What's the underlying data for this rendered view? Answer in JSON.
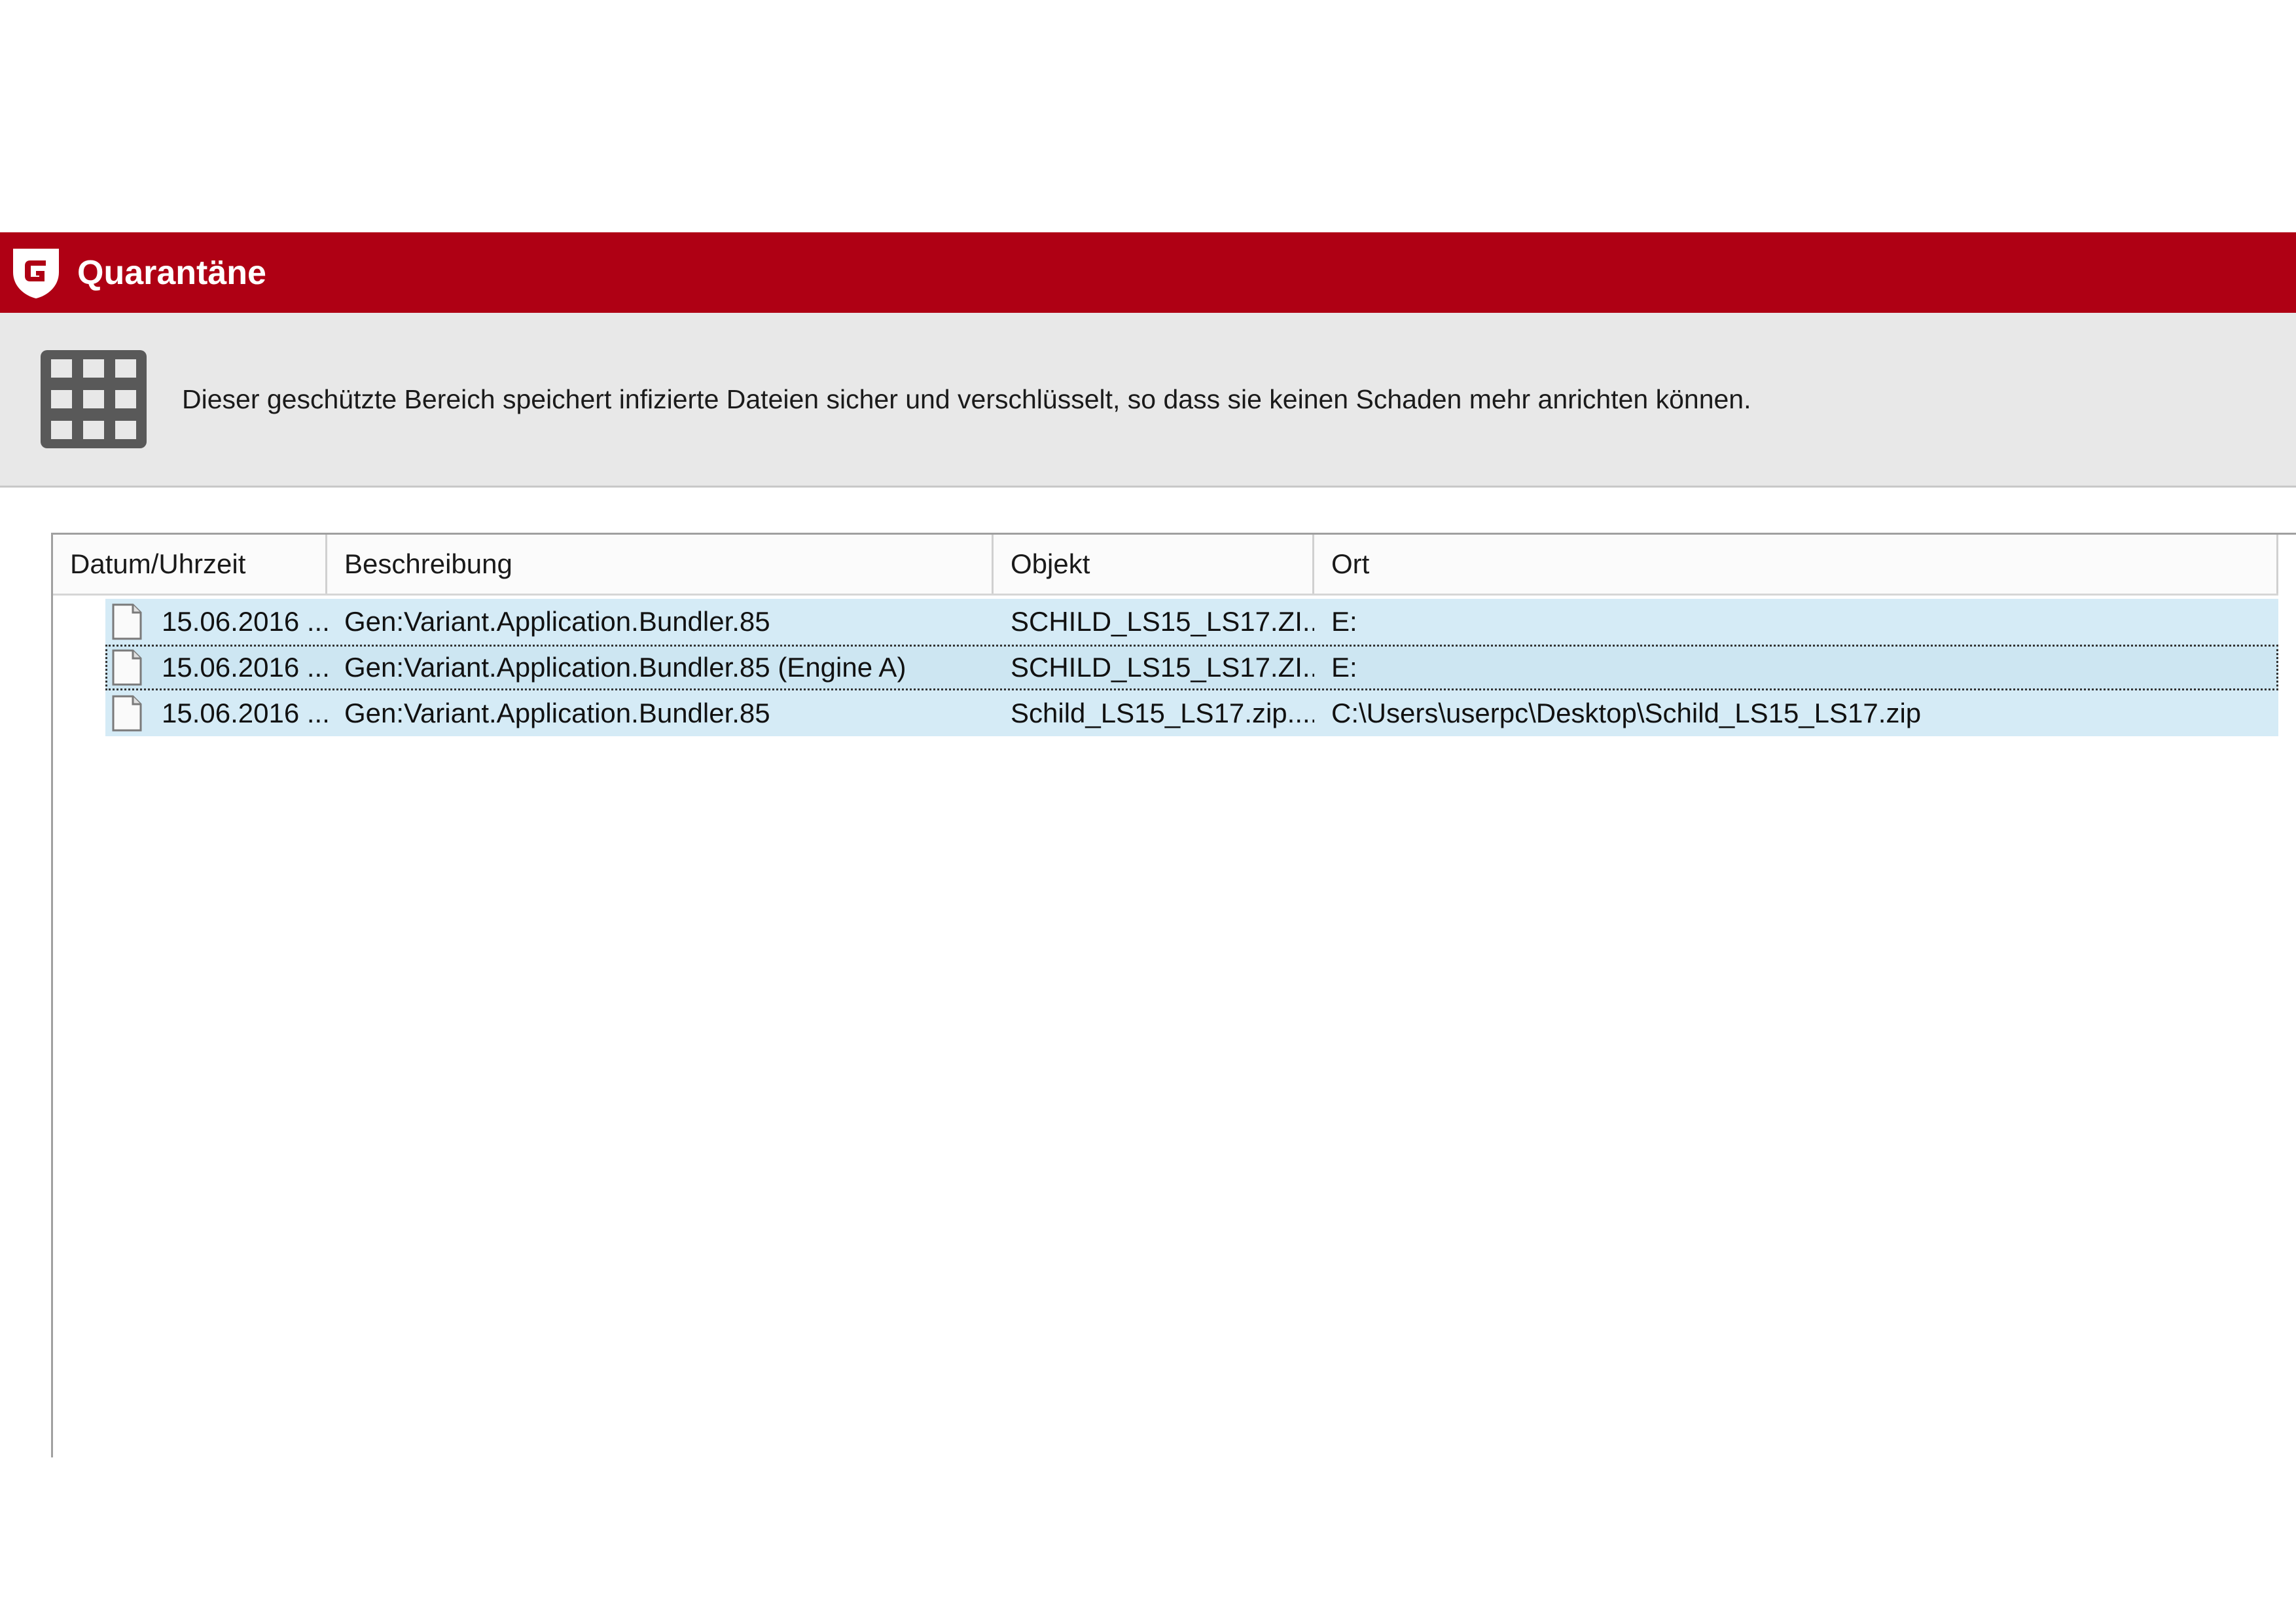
{
  "window": {
    "title": "Quarantäne",
    "brand_color": "#af0014"
  },
  "info": {
    "description": "Dieser geschützte Bereich speichert infizierte Dateien sicher und verschlüsselt, so dass sie keinen Schaden mehr anrichten können."
  },
  "table": {
    "columns": [
      "Datum/Uhrzeit",
      "Beschreibung",
      "Objekt",
      "Ort"
    ],
    "rows": [
      {
        "date": "15.06.2016 ...",
        "description": "Gen:Variant.Application.Bundler.85",
        "object": "SCHILD_LS15_LS17.ZI...",
        "location": "E:"
      },
      {
        "date": "15.06.2016 ...",
        "description": "Gen:Variant.Application.Bundler.85 (Engine A)",
        "object": "SCHILD_LS15_LS17.ZI...",
        "location": "E:"
      },
      {
        "date": "15.06.2016 ...",
        "description": "Gen:Variant.Application.Bundler.85",
        "object": "Schild_LS15_LS17.zip....",
        "location": "C:\\Users\\userpc\\Desktop\\Schild_LS15_LS17.zip"
      }
    ]
  },
  "icons": {
    "logo": "gdata-shield-icon",
    "header": "grid-icon",
    "row": "file-icon"
  }
}
